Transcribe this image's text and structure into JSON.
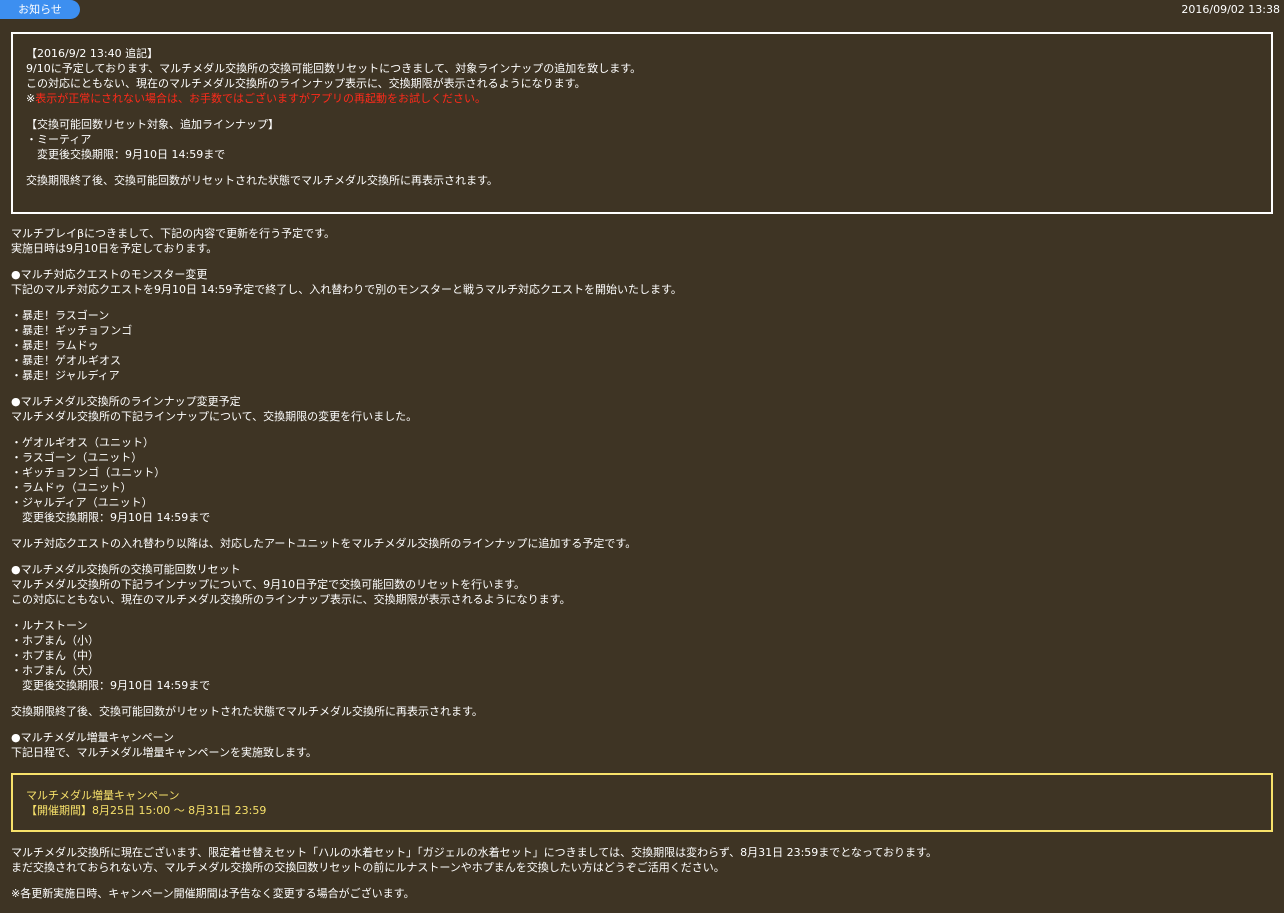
{
  "header": {
    "tab_label": "お知らせ",
    "date": "2016/09/02 13:38"
  },
  "addendum_box": {
    "line1": "【2016/9/2 13:40 追記】",
    "line2": "9/10に予定しております、マルチメダル交換所の交換可能回数リセットにつきまして、対象ラインナップの追加を致します。",
    "line3": "この対応にともない、現在のマルチメダル交換所のラインナップ表示に、交換期限が表示されるようになります。",
    "line4_prefix": "※",
    "line4_red": "表示が正常にされない場合は、お手数ではございますがアプリの再起動をお試しください。",
    "line5": "【交換可能回数リセット対象、追加ラインナップ】",
    "line6": "・ミーティア",
    "line7": "　変更後交換期限：9月10日 14:59まで",
    "line8": "交換期限終了後、交換可能回数がリセットされた状態でマルチメダル交換所に再表示されます。"
  },
  "body": {
    "intro1": "マルチプレイβにつきまして、下記の内容で更新を行う予定です。",
    "intro2": "実施日時は9月10日を予定しております。",
    "sec1_title": "●マルチ対応クエストのモンスター変更",
    "sec1_desc": "下記のマルチ対応クエストを9月10日 14:59予定で終了し、入れ替わりで別のモンスターと戦うマルチ対応クエストを開始いたします。",
    "sec1_items": [
      "・暴走！ラスゴーン",
      "・暴走！ギッチョフンゴ",
      "・暴走！ラムドゥ",
      "・暴走！ゲオルギオス",
      "・暴走！ジャルディア"
    ],
    "sec2_title": "●マルチメダル交換所のラインナップ変更予定",
    "sec2_desc": "マルチメダル交換所の下記ラインナップについて、交換期限の変更を行いました。",
    "sec2_items": [
      "・ゲオルギオス（ユニット）",
      "・ラスゴーン（ユニット）",
      "・ギッチョフンゴ（ユニット）",
      "・ラムドゥ（ユニット）",
      "・ジャルディア（ユニット）",
      "　変更後交換期限：9月10日 14:59まで"
    ],
    "sec2_note": "マルチ対応クエストの入れ替わり以降は、対応したアートユニットをマルチメダル交換所のラインナップに追加する予定です。",
    "sec3_title": "●マルチメダル交換所の交換可能回数リセット",
    "sec3_desc1": "マルチメダル交換所の下記ラインナップについて、9月10日予定で交換可能回数のリセットを行います。",
    "sec3_desc2": "この対応にともない、現在のマルチメダル交換所のラインナップ表示に、交換期限が表示されるようになります。",
    "sec3_items": [
      "・ルナストーン",
      "・ホプまん（小）",
      "・ホプまん（中）",
      "・ホプまん（大）",
      "　変更後交換期限：9月10日 14:59まで"
    ],
    "sec3_note": "交換期限終了後、交換可能回数がリセットされた状態でマルチメダル交換所に再表示されます。",
    "sec4_title": "●マルチメダル増量キャンペーン",
    "sec4_desc": "下記日程で、マルチメダル増量キャンペーンを実施致します。",
    "footer1": "マルチメダル交換所に現在ございます、限定着せ替えセット「ハルの水着セット」「ガジェルの水着セット」につきましては、交換期限は変わらず、8月31日 23:59までとなっております。",
    "footer2": "まだ交換されておられない方、マルチメダル交換所の交換回数リセットの前にルナストーンやホプまんを交換したい方はどうぞご活用ください。",
    "footer3": "※各更新実施日時、キャンペーン開催期間は予告なく変更する場合がございます。"
  },
  "campaign_box": {
    "title": "マルチメダル増量キャンペーン",
    "period": "【開催期間】8月25日 15:00 ～ 8月31日 23:59"
  }
}
